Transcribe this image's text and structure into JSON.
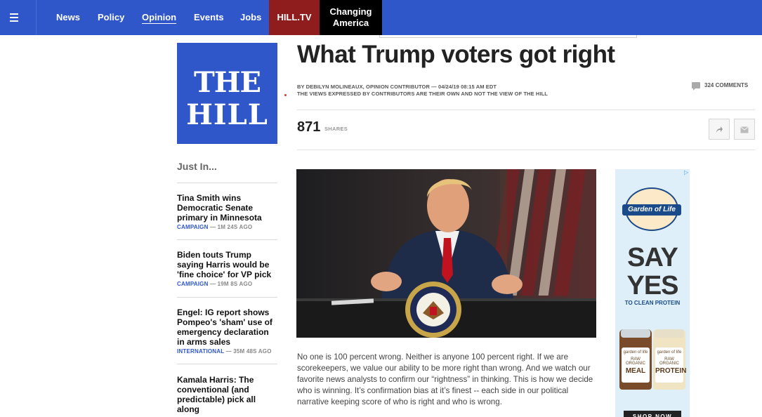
{
  "nav": {
    "links": [
      {
        "label": "News"
      },
      {
        "label": "Policy"
      },
      {
        "label": "Opinion",
        "active": true
      },
      {
        "label": "Events"
      },
      {
        "label": "Jobs"
      }
    ],
    "hilltv": "HILL.TV",
    "changing_line1": "Changing",
    "changing_line2": "America"
  },
  "logo": {
    "line1": "THE",
    "line2": "HILL"
  },
  "sidebar": {
    "heading": "Just In...",
    "stories": [
      {
        "title": "Tina Smith wins Democratic Senate primary in Minnesota",
        "category": "CAMPAIGN",
        "time": " — 1M 24S AGO"
      },
      {
        "title": "Biden touts Trump saying Harris would be 'fine choice' for VP pick",
        "category": "CAMPAIGN",
        "time": " — 19M 8S AGO"
      },
      {
        "title": "Engel: IG report shows Pompeo's 'sham' use of emergency declaration in arms sales",
        "category": "INTERNATIONAL",
        "time": " — 35M 48S AGO"
      },
      {
        "title": "Kamala Harris: The conventional (and predictable) pick all along",
        "category": "",
        "time": ""
      }
    ]
  },
  "article": {
    "headline": "What Trump voters got right",
    "byline": "BY DEBILYN MOLINEAUX, OPINION CONTRIBUTOR — 04/24/19 08:15 AM EDT",
    "disclaimer": "THE VIEWS EXPRESSED BY CONTRIBUTORS ARE THEIR OWN AND NOT THE VIEW OF THE HILL",
    "comments": "324 COMMENTS",
    "shares_count": "871",
    "shares_label": "SHARES",
    "body": "No one is 100 percent wrong. Neither is anyone 100 percent right. If we are scorekeepers, we value our ability to be more right than wrong. And we watch our favorite news analysts to confirm our “rightness” in thinking. This is how we decide who is winning. It’s confirmation bias at it’s finest -- each side in our political narrative keeping score of who is right and who is wrong."
  },
  "hero": {
    "seal_text": "SEAL OF THE PRESIDENT OF THE UNITED STATES"
  },
  "ad": {
    "brand": "Garden of Life",
    "say": "SAY",
    "yes": "YES",
    "tagline": "TO CLEAN PROTEIN",
    "jar1_brand": "garden of life",
    "jar1_small": "RAW ORGANIC",
    "jar1_big": "MEAL",
    "jar2_brand": "garden of life",
    "jar2_small": "RAW ORGANIC",
    "jar2_big": "PROTEIN",
    "shop": "SHOP NOW"
  }
}
